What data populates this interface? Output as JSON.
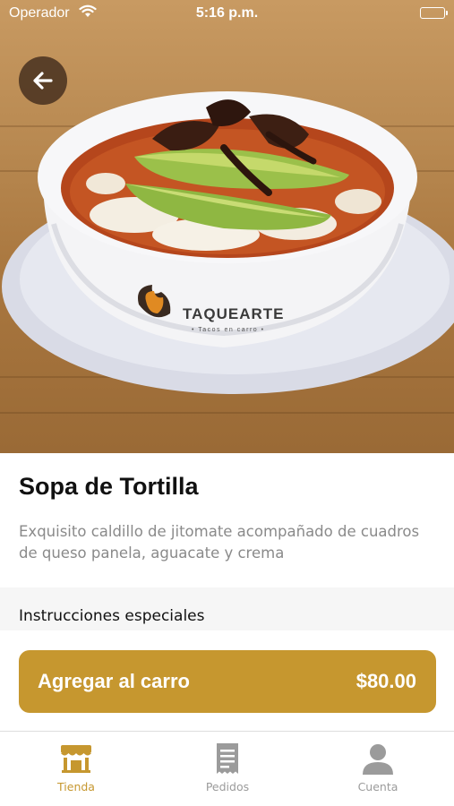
{
  "status_bar": {
    "carrier": "Operador",
    "time": "5:16 p.m."
  },
  "hero": {
    "brand_text": "TAQUEARTE",
    "brand_tagline": "• Tacos en carro •"
  },
  "product": {
    "title": "Sopa de Tortilla",
    "description": "Exquisito caldillo de jitomate acompañado de cuadros de queso panela, aguacate y crema"
  },
  "special_instructions": {
    "label": "Instrucciones especiales"
  },
  "cart_button": {
    "label": "Agregar al carro",
    "price": "$80.00"
  },
  "tab_bar": {
    "tabs": [
      {
        "label": "Tienda",
        "icon": "store-icon",
        "active": true
      },
      {
        "label": "Pedidos",
        "icon": "receipt-icon",
        "active": false
      },
      {
        "label": "Cuenta",
        "icon": "person-icon",
        "active": false
      }
    ]
  },
  "colors": {
    "accent": "#c6972f",
    "inactive": "#9b9b9b",
    "muted_text": "#8a8a8a"
  }
}
